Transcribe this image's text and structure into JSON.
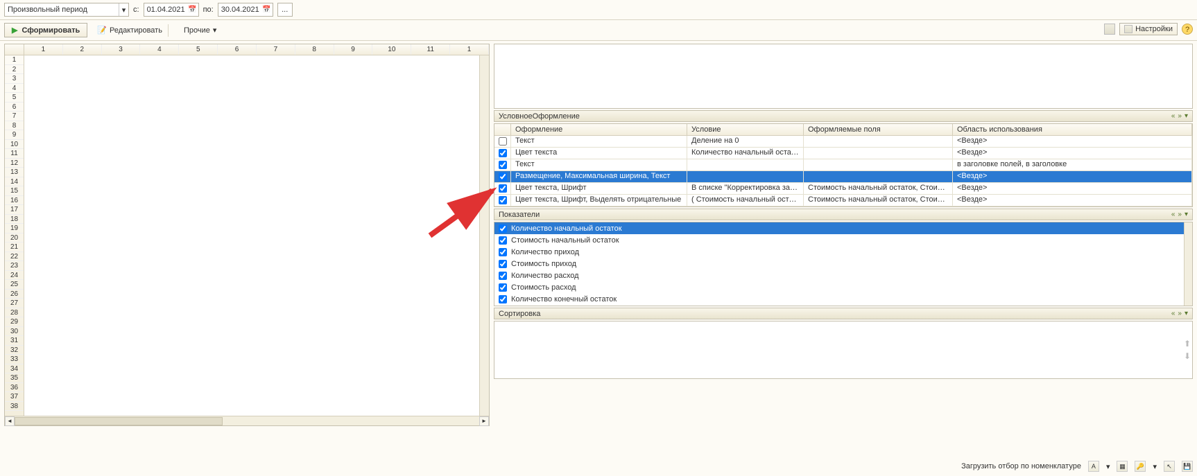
{
  "period": {
    "selector": "Произвольный период",
    "from_label": "с:",
    "from_value": "01.04.2021",
    "to_label": "по:",
    "to_value": "30.04.2021"
  },
  "toolbar": {
    "sform": "Сформировать",
    "edit": "Редактировать",
    "others": "Прочие",
    "settings": "Настройки"
  },
  "sheet": {
    "cols": [
      "1",
      "2",
      "3",
      "4",
      "5",
      "6",
      "7",
      "8",
      "9",
      "10",
      "11",
      "1"
    ],
    "rows": [
      "1",
      "2",
      "3",
      "4",
      "5",
      "6",
      "7",
      "8",
      "9",
      "10",
      "11",
      "12",
      "13",
      "14",
      "15",
      "16",
      "17",
      "18",
      "19",
      "20",
      "21",
      "22",
      "23",
      "24",
      "25",
      "26",
      "27",
      "28",
      "29",
      "30",
      "31",
      "32",
      "33",
      "34",
      "35",
      "36",
      "37",
      "38"
    ]
  },
  "cond": {
    "title": "УсловноеОформление",
    "headers": {
      "oform": "Оформление",
      "usl": "Условие",
      "polya": "Оформляемые поля",
      "obl": "Область использования"
    },
    "rows": [
      {
        "checked": false,
        "oform": "Текст",
        "usl": "Деление на 0",
        "polya": "",
        "obl": "<Везде>"
      },
      {
        "checked": true,
        "oform": "Цвет текста",
        "usl": "Количество начальный остаток ...",
        "polya": "",
        "obl": "<Везде>"
      },
      {
        "checked": true,
        "oform": "Текст",
        "usl": "",
        "polya": "",
        "obl": "в заголовке полей, в заголовке"
      },
      {
        "checked": true,
        "oform": "Размещение, Максимальная ширина, Текст",
        "usl": "",
        "polya": "",
        "obl": "<Везде>",
        "selected": true
      },
      {
        "checked": true,
        "oform": "Цвет текста, Шрифт",
        "usl": "В списке \"Корректировка запи..",
        "polya": "Стоимость начальный остаток, Стоимость ...",
        "obl": "<Везде>"
      },
      {
        "checked": true,
        "oform": "Цвет текста, Шрифт, Выделять отрицательные",
        "usl": "( Стоимость начальный остаток ...",
        "polya": "Стоимость начальный остаток, Стоимость ...",
        "obl": "<Везде>"
      }
    ]
  },
  "pokaz": {
    "title": "Показатели",
    "items": [
      {
        "checked": true,
        "label": "Количество начальный остаток",
        "selected": true
      },
      {
        "checked": true,
        "label": "Стоимость начальный остаток"
      },
      {
        "checked": true,
        "label": "Количество приход"
      },
      {
        "checked": true,
        "label": "Стоимость приход"
      },
      {
        "checked": true,
        "label": "Количество расход"
      },
      {
        "checked": true,
        "label": "Стоимость расход"
      },
      {
        "checked": true,
        "label": "Количество конечный остаток"
      }
    ]
  },
  "sort": {
    "title": "Сортировка"
  },
  "footer": {
    "load": "Загрузить отбор по номенклатуре"
  }
}
